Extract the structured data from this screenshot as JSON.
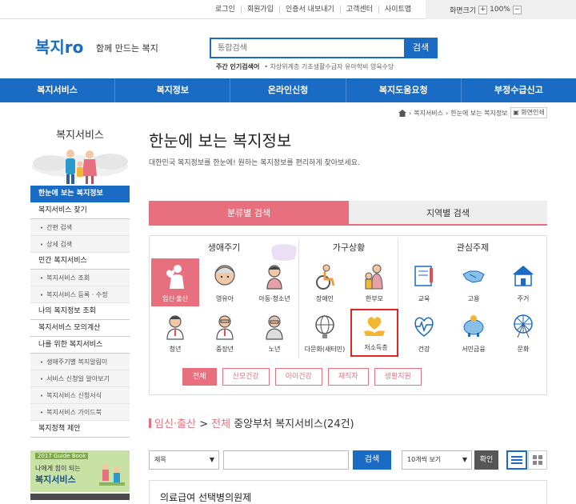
{
  "util_links": [
    "로그인",
    "회원가입",
    "인증서 내보내기",
    "고객센터",
    "사이트맵"
  ],
  "zoom": {
    "label": "화면크기",
    "plus": "+",
    "value": "100%",
    "minus": "−"
  },
  "logo": {
    "text": "복지ro"
  },
  "slogan": "함께 만드는 복지",
  "search": {
    "placeholder": "통합검색",
    "button": "검색"
  },
  "popular": {
    "label": "주간 인기검색어",
    "terms": "• 차상위계층 기초생활수급자 유아학비 양육수당"
  },
  "nav": [
    "복지서비스",
    "복지정보",
    "온라인신청",
    "복지도움요청",
    "부정수급신고"
  ],
  "breadcrumb": {
    "items": [
      "복지서비스",
      "한눈에 보는 복지정보"
    ],
    "print": "화면인쇄"
  },
  "sidebar": {
    "title": "복지서비스",
    "items": [
      {
        "label": "한눈에 보는 복지정보",
        "type": "active"
      },
      {
        "label": "복지서비스 찾기",
        "type": "main"
      },
      {
        "label": "간편 검색",
        "type": "sub"
      },
      {
        "label": "상세 검색",
        "type": "sub"
      },
      {
        "label": "민간 복지서비스",
        "type": "main"
      },
      {
        "label": "복지서비스 조회",
        "type": "sub"
      },
      {
        "label": "복지서비스 등록 · 수정",
        "type": "sub"
      },
      {
        "label": "나의 복지정보 조회",
        "type": "main"
      },
      {
        "label": "복지서비스 모의계산",
        "type": "main"
      },
      {
        "label": "나를 위한 복지서비스",
        "type": "main"
      },
      {
        "label": "생애주기별 복지알림이",
        "type": "sub"
      },
      {
        "label": "서비스 신청일 알아보기",
        "type": "sub"
      },
      {
        "label": "복지서비스 신청서식",
        "type": "sub"
      },
      {
        "label": "복지서비스 가이드북",
        "type": "sub"
      },
      {
        "label": "복지정책 제안",
        "type": "main"
      }
    ],
    "banner": {
      "year": "2017 Guide Book",
      "line1": "나에게 힘이 되는",
      "line2": "복지서비스"
    }
  },
  "main": {
    "title": "한눈에 보는 복지정보",
    "desc": "대한민국 복지정보를 한눈에! 원하는 복지정보를 편리하게 찾아보세요.",
    "tabs": [
      "분류별 검색",
      "지역별 검색"
    ],
    "columns": [
      "생애주기",
      "가구상황",
      "관심주제"
    ],
    "life": [
      "임신·출산",
      "영유아",
      "아동·청소년",
      "청년",
      "중장년",
      "노년"
    ],
    "household": [
      "장애인",
      "한부모",
      "다문화(새터민)",
      "저소득층"
    ],
    "topics": [
      "교육",
      "고용",
      "주거",
      "건강",
      "서민금융",
      "문화"
    ],
    "chips": [
      "전체",
      "산모건강",
      "아이건강",
      "재직자",
      "생활지원"
    ],
    "result": {
      "cat": "임신·출산",
      "sep": " > ",
      "sub": "전체",
      "rest": " 중앙부처 복지서비스(24건)"
    },
    "sort": "제목",
    "count": "10개씩 보기",
    "kw_button": "검색",
    "confirm": "확인",
    "first_item": "의료급여 선택병의원제"
  },
  "colors": {
    "blue": "#1a6bc4",
    "pink": "#e8707e",
    "red": "#e02424"
  }
}
